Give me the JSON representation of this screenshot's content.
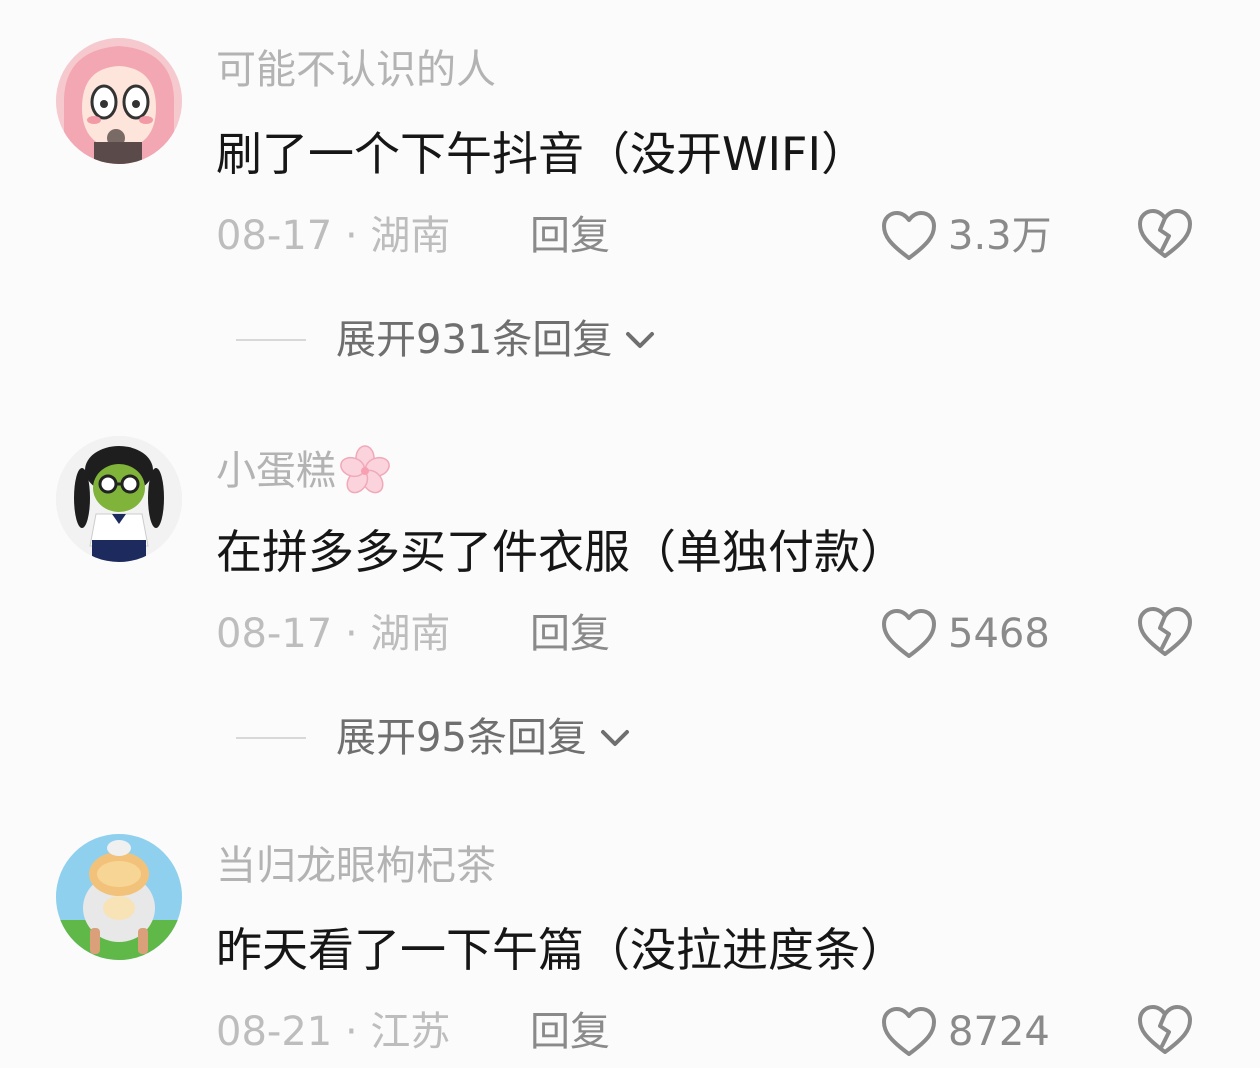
{
  "comments": [
    {
      "username": "可能不认识的人",
      "text": "刷了一个下午抖音（没开WIFI）",
      "date_location": "08-17 · 湖南",
      "reply_label": "回复",
      "likes": "3.3万",
      "expand_label": "展开931条回复"
    },
    {
      "username": "小蛋糕",
      "text": "在拼多多买了件衣服（单独付款）",
      "date_location": "08-17 · 湖南",
      "reply_label": "回复",
      "likes": "5468",
      "expand_label": "展开95条回复"
    },
    {
      "username": "当归龙眼枸杞茶",
      "text": "昨天看了一下午篇（没拉进度条）",
      "date_location": "08-21 · 江苏",
      "reply_label": "回复",
      "likes": "8724"
    }
  ],
  "icons": {
    "like": "heart-outline-icon",
    "dislike": "broken-heart-icon",
    "expand": "chevron-down-icon",
    "flower": "sakura-emoji-icon"
  },
  "colors": {
    "background": "#fbfbfb",
    "username": "#b3b3b3",
    "text": "#161616",
    "meta": "#bdbdbd",
    "action": "#8a8a8a"
  }
}
